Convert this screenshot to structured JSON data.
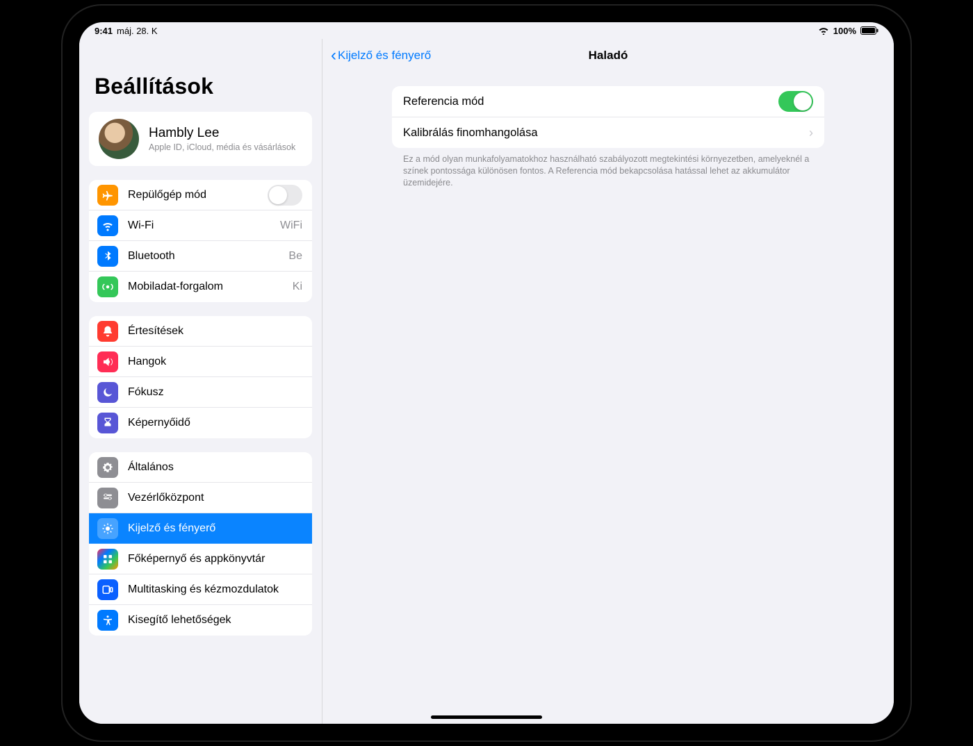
{
  "statusbar": {
    "time": "9:41",
    "date": "máj. 28. K",
    "battery_pct": "100%"
  },
  "sidebar": {
    "title": "Beállítások",
    "profile": {
      "name": "Hambly Lee",
      "subtitle": "Apple ID, iCloud, média és vásárlások"
    },
    "group_connectivity": {
      "airplane": {
        "label": "Repülőgép mód",
        "on": false
      },
      "wifi": {
        "label": "Wi-Fi",
        "value": "WiFi"
      },
      "bluetooth": {
        "label": "Bluetooth",
        "value": "Be"
      },
      "cellular": {
        "label": "Mobiladat-forgalom",
        "value": "Ki"
      }
    },
    "group_notifications": {
      "notifications": "Értesítések",
      "sounds": "Hangok",
      "focus": "Fókusz",
      "screentime": "Képernyőidő"
    },
    "group_general": {
      "general": "Általános",
      "controlcenter": "Vezérlőközpont",
      "display": "Kijelző és fényerő",
      "homescreen": "Főképernyő és appkönyvtár",
      "multitasking": "Multitasking és kézmozdulatok",
      "accessibility": "Kisegítő lehetőségek"
    }
  },
  "main": {
    "back_label": "Kijelző és fényerő",
    "title": "Haladó",
    "reference_mode": {
      "label": "Referencia mód",
      "on": true
    },
    "calibration": {
      "label": "Kalibrálás finomhangolása"
    },
    "footer": "Ez a mód olyan munkafolyamatokhoz használható szabályozott megtekintési környezetben, amelyeknél a színek pontossága különösen fontos. A Referencia mód bekapcsolása hatással lehet az akkumulátor üzemidejére."
  }
}
